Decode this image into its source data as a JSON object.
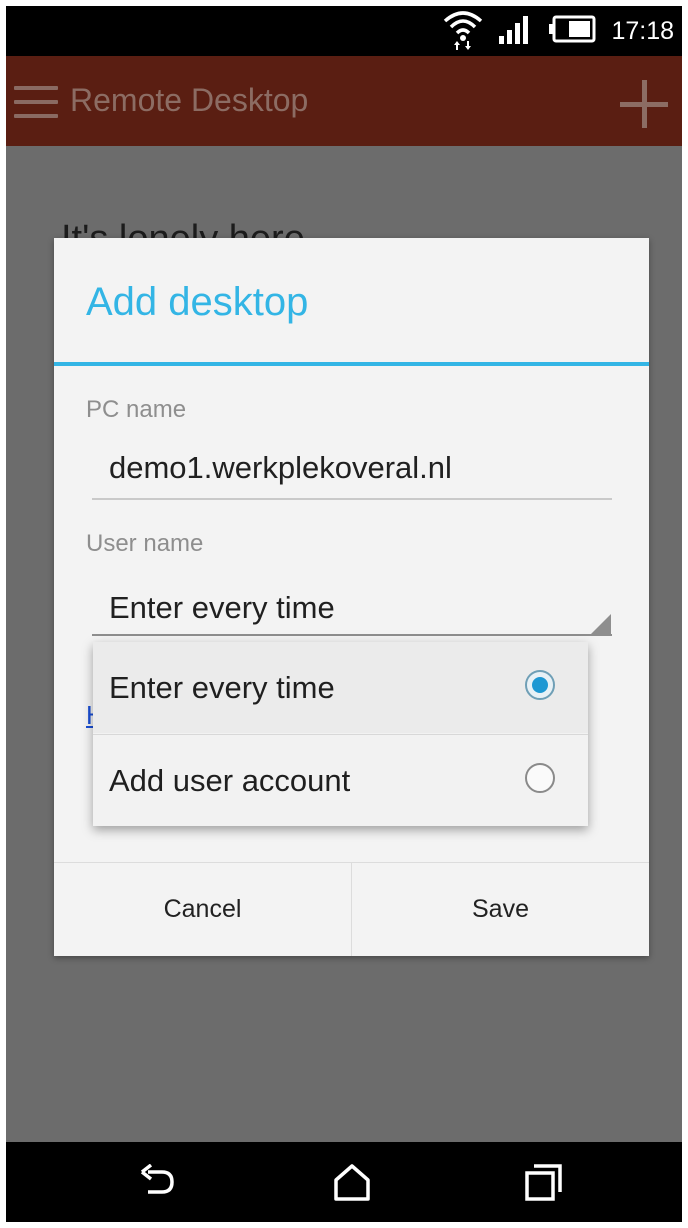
{
  "status_bar": {
    "time": "17:18",
    "icons": [
      "wifi-icon",
      "signal-icon",
      "battery-icon"
    ]
  },
  "app_bar": {
    "title": "Remote Desktop",
    "menu_icon": "hamburger-menu-icon",
    "add_icon": "plus-icon"
  },
  "background": {
    "empty_message": "It's lonely here"
  },
  "dialog": {
    "title": "Add desktop",
    "pc_name_label": "PC name",
    "pc_name_value": "demo1.werkplekoveral.nl",
    "user_name_label": "User name",
    "user_name_value": "Enter every time",
    "partial_link": "H",
    "partial_text": "·",
    "cancel_label": "Cancel",
    "save_label": "Save"
  },
  "dropdown": {
    "options": [
      {
        "label": "Enter every time",
        "selected": true
      },
      {
        "label": "Add user account",
        "selected": false
      }
    ]
  },
  "nav_bar": {
    "icons": [
      "back-icon",
      "home-icon",
      "recent-apps-icon"
    ]
  },
  "colors": {
    "accent": "#33b5e5",
    "app_bar": "#5a1e12",
    "radio_selected": "#1e98d3"
  }
}
